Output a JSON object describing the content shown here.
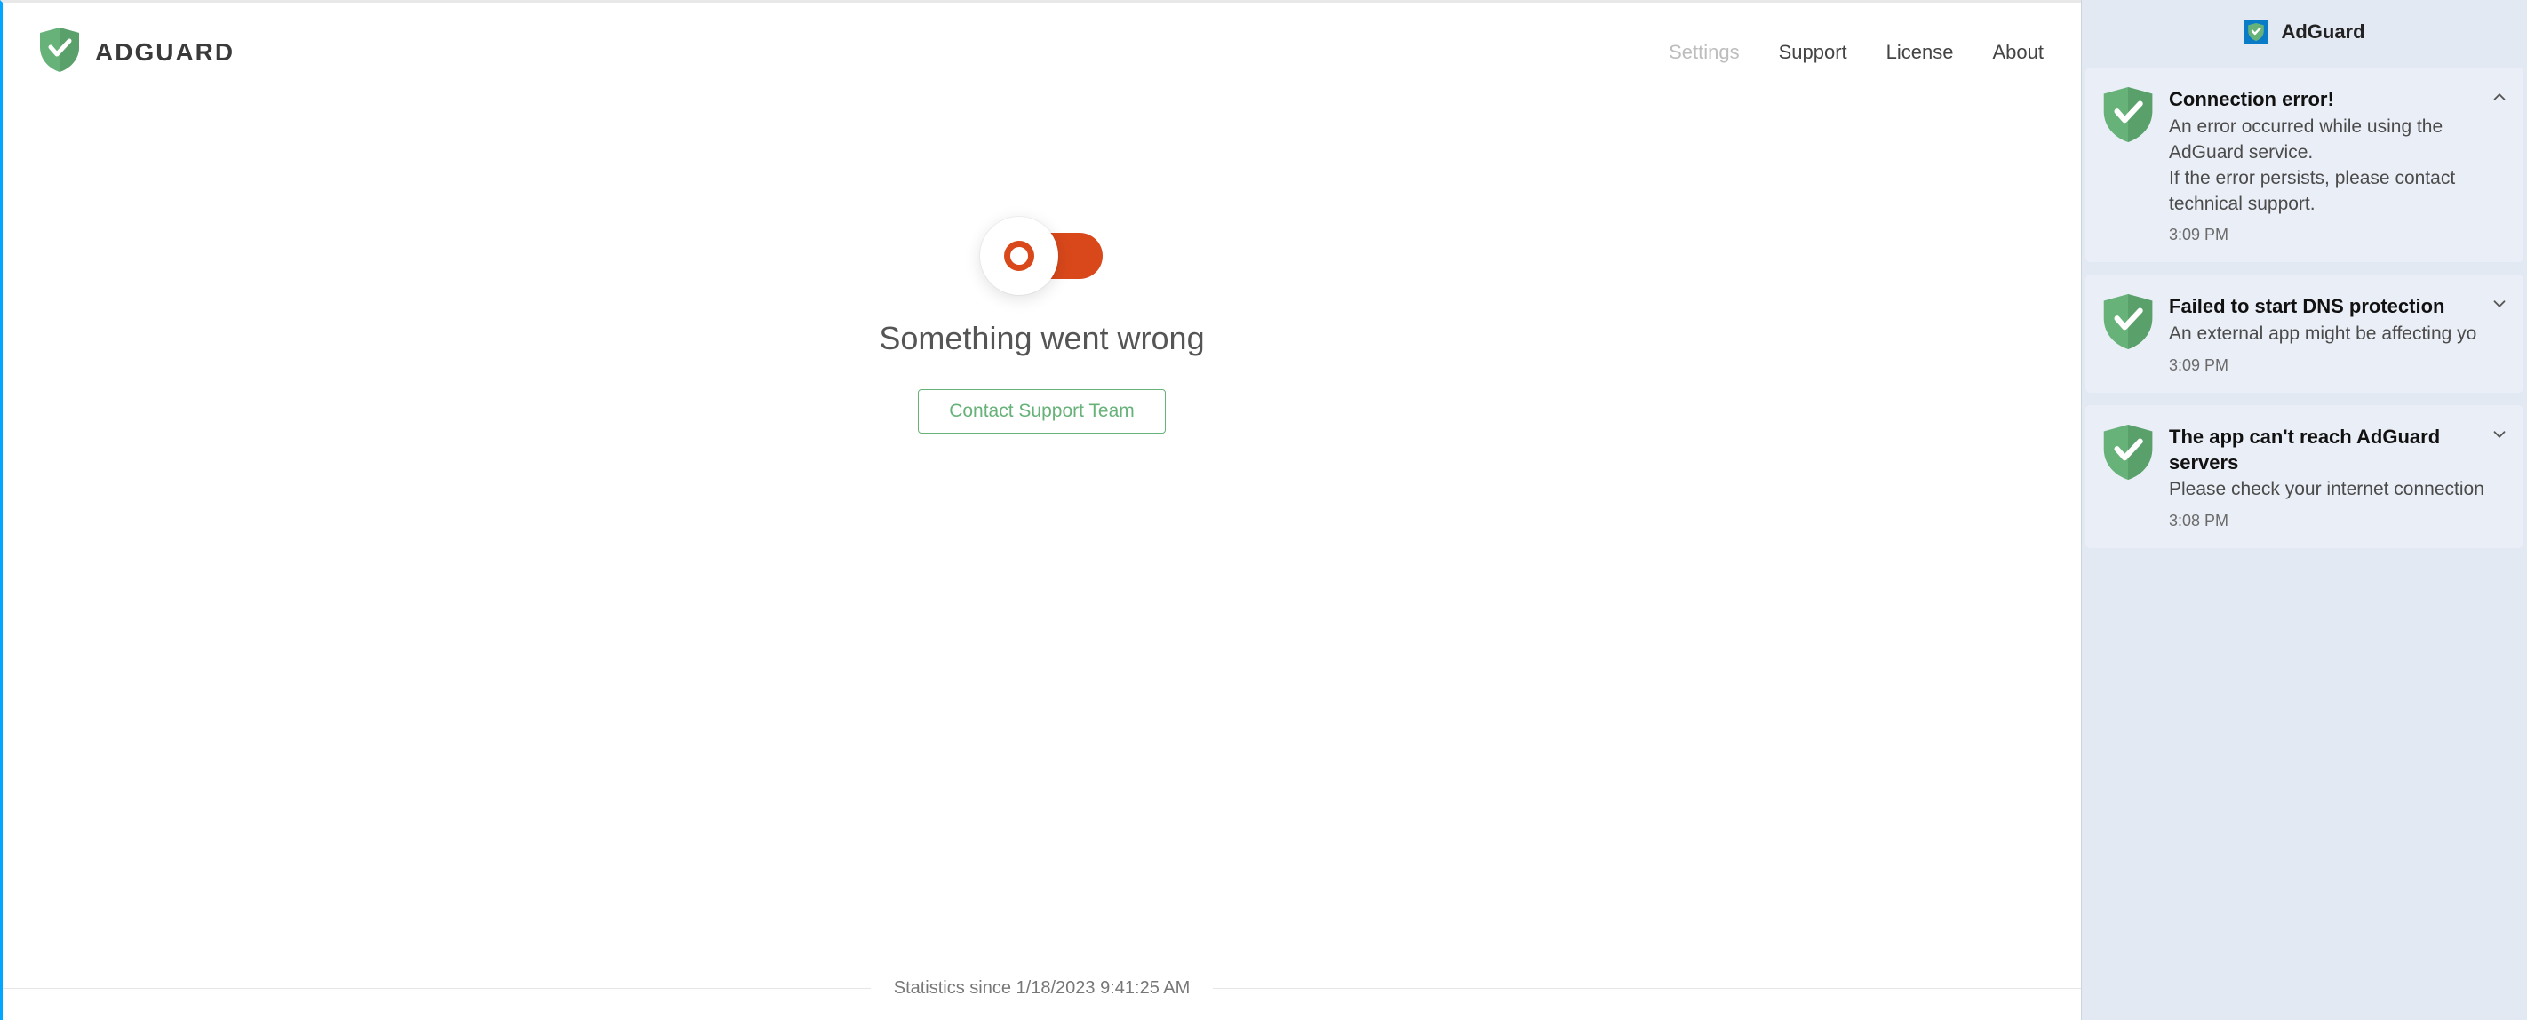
{
  "brand": {
    "name": "ADGUARD"
  },
  "nav": {
    "settings": "Settings",
    "support": "Support",
    "license": "License",
    "about": "About"
  },
  "main": {
    "error_heading": "Something went wrong",
    "support_button": "Contact Support Team",
    "stats_label": "Statistics since 1/18/2023 9:41:25 AM"
  },
  "notif_panel": {
    "app_name": "AdGuard",
    "items": [
      {
        "title": "Connection error!",
        "message": "An error occurred while using the AdGuard service.\nIf the error persists, please contact technical support.",
        "time": "3:09 PM",
        "expanded": true
      },
      {
        "title": "Failed to start DNS protection",
        "message": "An external app might be affecting yo",
        "time": "3:09 PM",
        "expanded": false
      },
      {
        "title": "The app can't reach AdGuard servers",
        "message": "Please check your internet connection",
        "time": "3:08 PM",
        "expanded": false
      }
    ]
  },
  "colors": {
    "brand_green": "#67b279",
    "error_orange": "#d9481b",
    "panel_bg": "#e3e9f3"
  }
}
